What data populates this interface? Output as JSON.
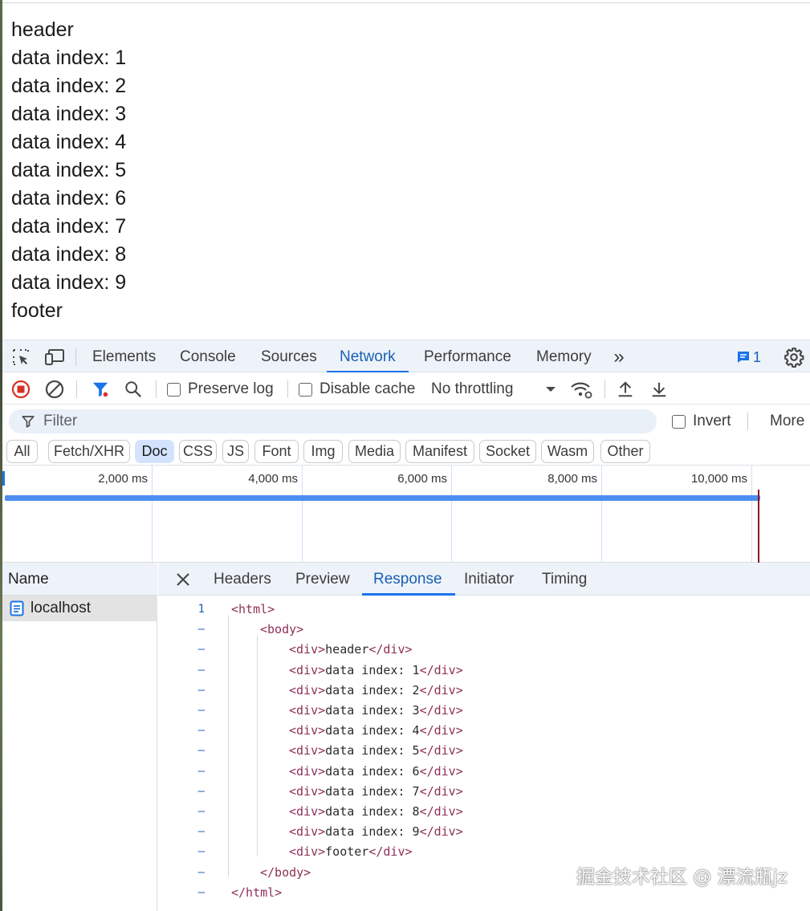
{
  "page": {
    "lines": [
      "header",
      "data index: 1",
      "data index: 2",
      "data index: 3",
      "data index: 4",
      "data index: 5",
      "data index: 6",
      "data index: 7",
      "data index: 8",
      "data index: 9",
      "footer"
    ]
  },
  "devtools": {
    "tabs": [
      "Elements",
      "Console",
      "Sources",
      "Network",
      "Performance",
      "Memory"
    ],
    "active_tab": "Network",
    "more_tabs": "»",
    "issues_count": "1",
    "toolbar": {
      "preserve_log": "Preserve log",
      "disable_cache": "Disable cache",
      "throttling": "No throttling"
    },
    "filter": {
      "placeholder": "Filter",
      "invert": "Invert",
      "more": "More"
    },
    "type_filters": [
      "All",
      "Fetch/XHR",
      "Doc",
      "CSS",
      "JS",
      "Font",
      "Img",
      "Media",
      "Manifest",
      "Socket",
      "Wasm",
      "Other"
    ],
    "active_type_filter": "Doc",
    "timeline_ticks": [
      "2,000 ms",
      "4,000 ms",
      "6,000 ms",
      "8,000 ms",
      "10,000 ms"
    ],
    "request_list": {
      "header": "Name",
      "rows": [
        "localhost"
      ]
    },
    "detail_tabs": [
      "Headers",
      "Preview",
      "Response",
      "Initiator",
      "Timing"
    ],
    "active_detail_tab": "Response",
    "response": [
      {
        "gutter": "1",
        "text": "<html>"
      },
      {
        "gutter": "–",
        "text": "<body>"
      },
      {
        "gutter": "–",
        "text": "<div>header</div>"
      },
      {
        "gutter": "–",
        "text": "<div>data index: 1</div>"
      },
      {
        "gutter": "–",
        "text": "<div>data index: 2</div>"
      },
      {
        "gutter": "–",
        "text": "<div>data index: 3</div>"
      },
      {
        "gutter": "–",
        "text": "<div>data index: 4</div>"
      },
      {
        "gutter": "–",
        "text": "<div>data index: 5</div>"
      },
      {
        "gutter": "–",
        "text": "<div>data index: 6</div>"
      },
      {
        "gutter": "–",
        "text": "<div>data index: 7</div>"
      },
      {
        "gutter": "–",
        "text": "<div>data index: 8</div>"
      },
      {
        "gutter": "–",
        "text": "<div>data index: 9</div>"
      },
      {
        "gutter": "–",
        "text": "<div>footer</div>"
      },
      {
        "gutter": "–",
        "text": "</body>"
      },
      {
        "gutter": "–",
        "text": "</html>"
      }
    ]
  },
  "watermark": "掘金技术社区 @ 漂流瓶jz",
  "colors": {
    "accent": "#1a73e8",
    "record": "#d93025",
    "waterfall": "#4d8ef0",
    "tag": "#8e2f55"
  }
}
